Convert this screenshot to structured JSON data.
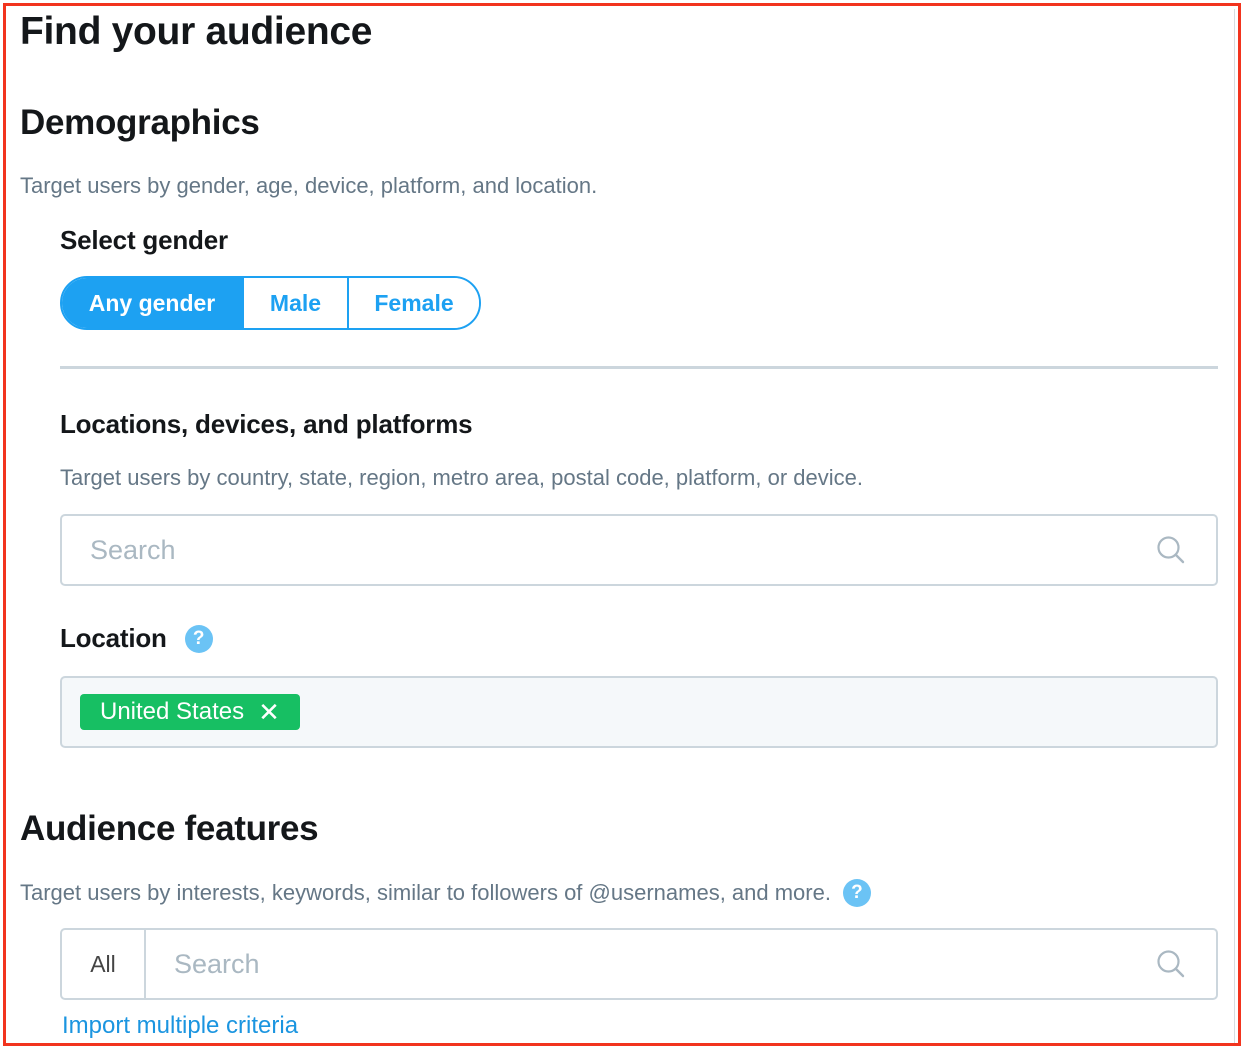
{
  "page": {
    "title": "Find your audience"
  },
  "demographics": {
    "heading": "Demographics",
    "description": "Target users by gender, age, device, platform, and location.",
    "gender": {
      "label": "Select gender",
      "options": [
        "Any gender",
        "Male",
        "Female"
      ],
      "selected": "Any gender"
    },
    "locations": {
      "heading": "Locations, devices, and platforms",
      "description": "Target users by country, state, region, metro area, postal code, platform, or device.",
      "search_placeholder": "Search"
    },
    "location": {
      "label": "Location",
      "help_icon": "question-mark-icon",
      "selected": [
        {
          "label": "United States",
          "remove_icon": "close-icon"
        }
      ]
    }
  },
  "audience_features": {
    "heading": "Audience features",
    "description": "Target users by interests, keywords, similar to followers of @usernames, and more.",
    "help_icon": "question-mark-icon",
    "filter_label": "All",
    "search_placeholder": "Search",
    "import_link": "Import multiple criteria"
  },
  "colors": {
    "accent": "#1da1f2",
    "chip": "#17bf63",
    "help": "#6bc3f5",
    "frame": "#f2341e"
  }
}
